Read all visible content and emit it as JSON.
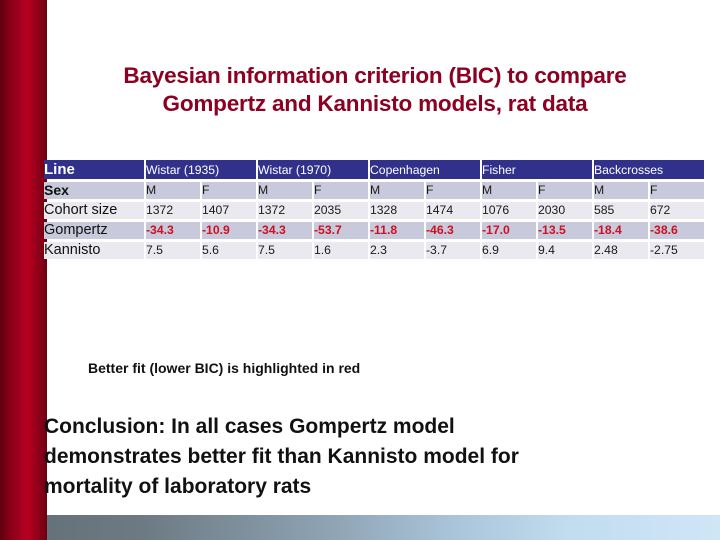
{
  "slide": {
    "title_line1": "Bayesian information criterion (BIC) to compare",
    "title_line2": "Gompertz and Kannisto models, rat data",
    "caption": "Better fit (lower BIC) is highlighted in red",
    "conclusion": "Conclusion: In all cases Gompertz model demonstrates better fit than Kannisto model for mortality of laboratory rats"
  },
  "colors": {
    "title": "#8c0022",
    "header_bg": "#31318c",
    "header_text": "#ffffff",
    "row_shade": "#c9c9dc",
    "row_light": "#e9e9ef",
    "highlight_red": "#cc1122",
    "left_bar": "#a3001e"
  },
  "table": {
    "header": {
      "line_label": "Line",
      "groups": [
        "Wistar (1935)",
        "Wistar (1970)",
        "Copenhagen",
        "Fisher",
        "Backcrosses"
      ]
    },
    "rows": [
      {
        "label": "Sex",
        "values": [
          "M",
          "F",
          "M",
          "F",
          "M",
          "F",
          "M",
          "F",
          "M",
          "F"
        ]
      },
      {
        "label": "Cohort size",
        "values": [
          "1372",
          "1407",
          "1372",
          "2035",
          "1328",
          "1474",
          "1076",
          "2030",
          "585",
          "672"
        ]
      },
      {
        "label": "Gompertz",
        "values": [
          "-34.3",
          "-10.9",
          "-34.3",
          "-53.7",
          "-11.8",
          "-46.3",
          "-17.0",
          "-13.5",
          "-18.4",
          "-38.6"
        ]
      },
      {
        "label": "Kannisto",
        "values": [
          "7.5",
          "5.6",
          "7.5",
          "1.6",
          "2.3",
          "-3.7",
          "6.9",
          "9.4",
          "2.48",
          "-2.75"
        ]
      }
    ]
  },
  "chart_data": {
    "type": "table",
    "title": "Bayesian information criterion (BIC) to compare Gompertz and Kannisto models, rat data",
    "columns": [
      "Line",
      "Wistar (1935) M",
      "Wistar (1935) F",
      "Wistar (1970) M",
      "Wistar (1970) F",
      "Copenhagen M",
      "Copenhagen F",
      "Fisher M",
      "Fisher F",
      "Backcrosses M",
      "Backcrosses F"
    ],
    "row_headers": [
      "Sex",
      "Cohort size",
      "Gompertz",
      "Kannisto"
    ],
    "series": [
      {
        "name": "Cohort size",
        "values": [
          1372,
          1407,
          1372,
          2035,
          1328,
          1474,
          1076,
          2030,
          585,
          672
        ]
      },
      {
        "name": "Gompertz",
        "values": [
          -34.3,
          -10.9,
          -34.3,
          -53.7,
          -11.8,
          -46.3,
          -17.0,
          -13.5,
          -18.4,
          -38.6
        ]
      },
      {
        "name": "Kannisto",
        "values": [
          7.5,
          5.6,
          7.5,
          1.6,
          2.3,
          -3.7,
          6.9,
          9.4,
          2.48,
          -2.75
        ]
      }
    ],
    "annotations": [
      "Better fit (lower BIC) is highlighted in red",
      "Conclusion: In all cases Gompertz model demonstrates better fit than Kannisto model for mortality of laboratory rats"
    ],
    "highlighted_series": "Gompertz"
  }
}
